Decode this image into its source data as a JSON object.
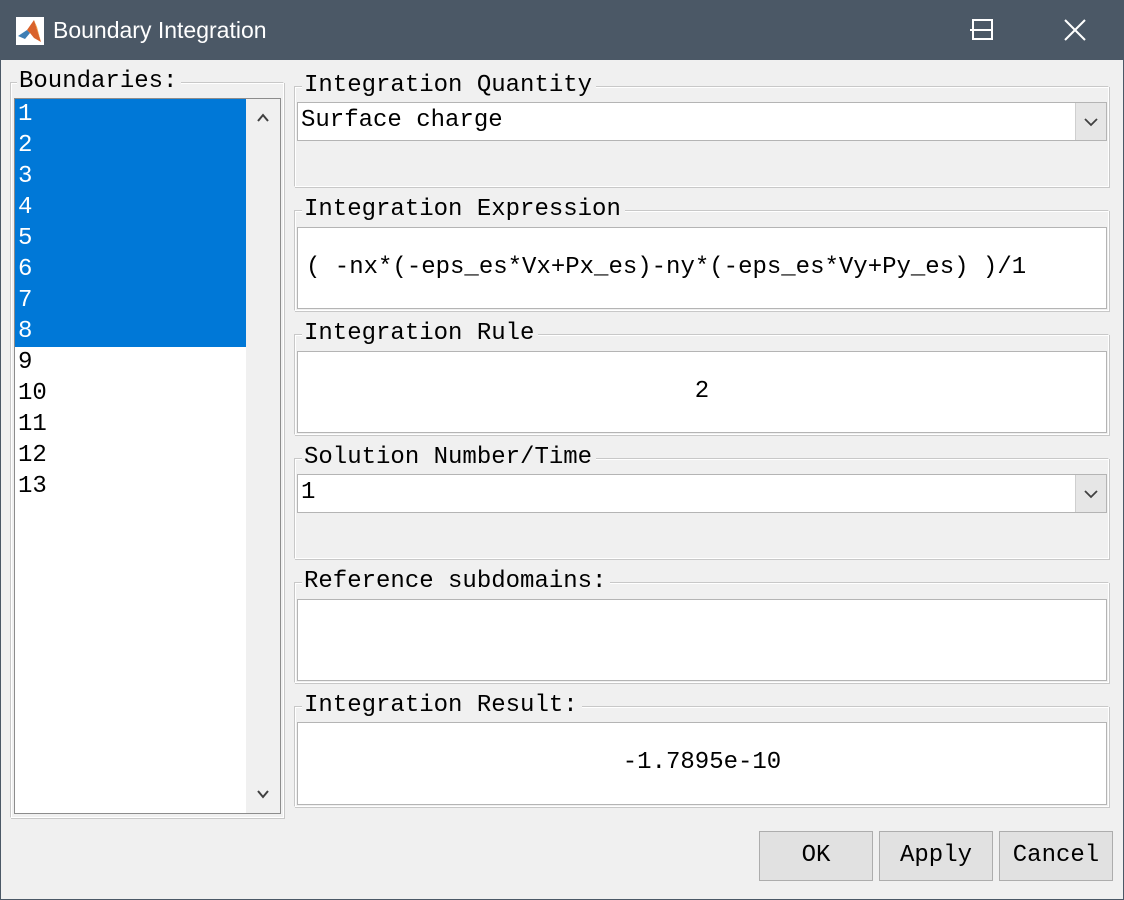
{
  "window": {
    "title": "Boundary Integration",
    "colors": {
      "titlebar": "#4b5866",
      "selection": "#0078d7"
    }
  },
  "boundaries": {
    "label": "Boundaries:",
    "items": [
      "1",
      "2",
      "3",
      "4",
      "5",
      "6",
      "7",
      "8",
      "9",
      "10",
      "11",
      "12",
      "13"
    ],
    "selected": [
      "1",
      "2",
      "3",
      "4",
      "5",
      "6",
      "7",
      "8"
    ]
  },
  "integration_quantity": {
    "label": "Integration Quantity",
    "value": "Surface charge"
  },
  "integration_expression": {
    "label": "Integration Expression",
    "value": "( -nx*(-eps_es*Vx+Px_es)-ny*(-eps_es*Vy+Py_es) )/1"
  },
  "integration_rule": {
    "label": "Integration Rule",
    "value": "2"
  },
  "solution_number": {
    "label": "Solution Number/Time",
    "value": "1"
  },
  "reference_subdomains": {
    "label": "Reference subdomains:",
    "value": ""
  },
  "integration_result": {
    "label": "Integration Result:",
    "value": "-1.7895e-10"
  },
  "buttons": {
    "ok": "OK",
    "apply": "Apply",
    "cancel": "Cancel"
  }
}
